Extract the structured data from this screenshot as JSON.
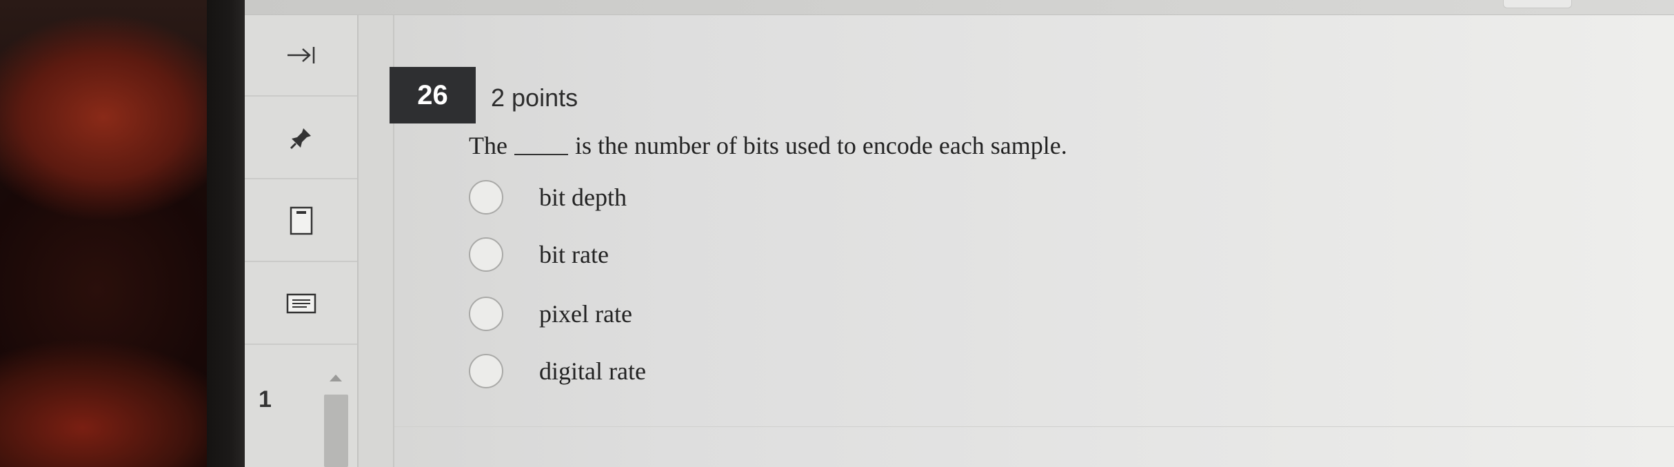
{
  "sidebar": {
    "collapse_icon": "arrow-right-to-bar-icon",
    "pin_icon": "pin-icon",
    "page_icon": "page-icon",
    "notes_icon": "notes-icon",
    "current_question_number": "1"
  },
  "question": {
    "number": "26",
    "points": "2 points",
    "text_before_blank": "The",
    "text_after_blank": "is the number of bits used to encode each sample.",
    "options": [
      {
        "label": "bit depth",
        "selected": false
      },
      {
        "label": "bit rate",
        "selected": false
      },
      {
        "label": "pixel rate",
        "selected": false
      },
      {
        "label": "digital rate",
        "selected": false
      }
    ]
  },
  "colors": {
    "question_number_bg": "#2e2f31",
    "question_number_text": "#ffffff",
    "text": "#222222"
  }
}
